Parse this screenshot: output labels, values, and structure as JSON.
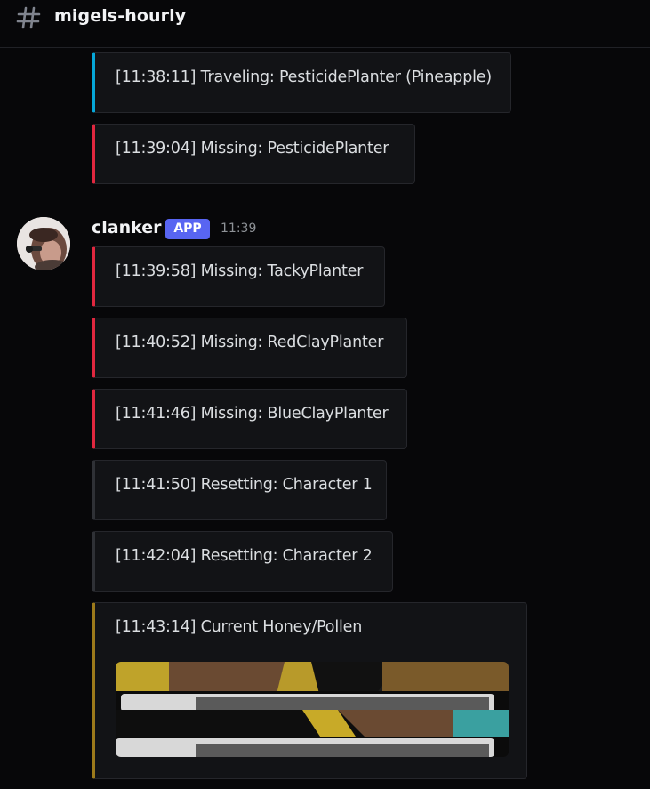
{
  "channel": {
    "name": "migels-hourly",
    "icon": "hash-icon"
  },
  "colors": {
    "cyan": "#06a7d8",
    "red": "#e0273f",
    "dark": "#2f3136",
    "gold": "#9c7a1b",
    "app_badge": "#5865f2"
  },
  "earlier_messages": [
    {
      "text": "[11:38:11] Traveling: PesticidePlanter (Pineapple)",
      "color": "cyan"
    },
    {
      "text": "[11:39:04] Missing: PesticidePlanter",
      "color": "red"
    }
  ],
  "message": {
    "author": "clanker",
    "badge": "APP",
    "time": "11:39",
    "embeds": [
      {
        "text": "[11:39:58] Missing: TackyPlanter",
        "color": "red"
      },
      {
        "text": "[11:40:52] Missing: RedClayPlanter",
        "color": "red"
      },
      {
        "text": "[11:41:46] Missing: BlueClayPlanter",
        "color": "red"
      },
      {
        "text": "[11:41:50] Resetting: Character 1",
        "color": "dark"
      },
      {
        "text": "[11:42:04] Resetting: Character 2",
        "color": "dark"
      },
      {
        "text": "[11:43:14] Current Honey/Pollen",
        "color": "gold",
        "has_image": true
      }
    ]
  }
}
